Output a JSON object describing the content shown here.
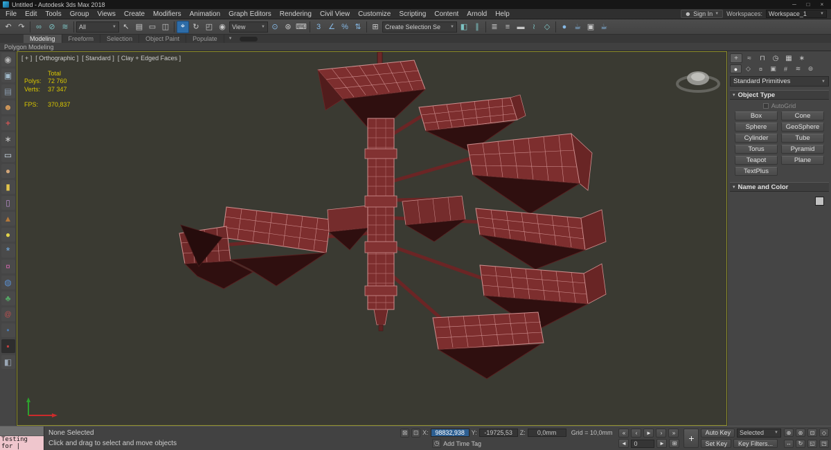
{
  "window": {
    "title": "Untitled - Autodesk 3ds Max 2018"
  },
  "menu": [
    "File",
    "Edit",
    "Tools",
    "Group",
    "Views",
    "Create",
    "Modifiers",
    "Animation",
    "Graph Editors",
    "Rendering",
    "Civil View",
    "Customize",
    "Scripting",
    "Content",
    "Arnold",
    "Help"
  ],
  "account": {
    "sign_in": "Sign In",
    "workspaces_label": "Workspaces:",
    "workspace": "Workspace_1"
  },
  "toolbar": {
    "filter": "All",
    "coord_system": "View",
    "selection_set": "Create Selection Se"
  },
  "ribbon": {
    "tabs": [
      "Modeling",
      "Freeform",
      "Selection",
      "Object Paint",
      "Populate"
    ],
    "panel": "Polygon Modeling"
  },
  "viewport": {
    "label_plus": "[ + ]",
    "label_view": "[ Orthographic ]",
    "label_style": "[ Standard ]",
    "label_shading": "[ Clay + Edged Faces ]",
    "stats": {
      "total": "Total",
      "polys_label": "Polys:",
      "polys": "72 760",
      "verts_label": "Verts:",
      "verts": "37 347",
      "fps_label": "FPS:",
      "fps": "370,837"
    }
  },
  "command_panel": {
    "category": "Standard Primitives",
    "object_type": "Object Type",
    "autogrid": "AutoGrid",
    "buttons": [
      "Box",
      "Cone",
      "Sphere",
      "GeoSphere",
      "Cylinder",
      "Tube",
      "Torus",
      "Pyramid",
      "Teapot",
      "Plane",
      "TextPlus"
    ],
    "name_color": "Name and Color"
  },
  "status": {
    "listener": "Testing for |",
    "prompt": "None Selected",
    "hint": "Click and drag to select and move objects",
    "x_label": "X:",
    "x": "98832,938",
    "y_label": "Y:",
    "y": "-19725,53",
    "z_label": "Z:",
    "z": "0,0mm",
    "grid": "Grid = 10,0mm",
    "add_time_tag": "Add Time Tag",
    "auto_key": "Auto Key",
    "set_key": "Set Key",
    "selected": "Selected",
    "key_filters": "Key Filters...",
    "frame": "0"
  },
  "icons": {
    "minimize": "─",
    "maximize": "□",
    "close": "×",
    "user": "☻",
    "dropdown": "▼",
    "rollout_open": "▾",
    "undo": "↶",
    "redo": "↷",
    "link": "∞",
    "unlink": "⊘",
    "bind": "≋",
    "select": "↖",
    "select_by_name": "▤",
    "region": "▭",
    "crossing": "◫",
    "move": "⌖",
    "rotate": "↻",
    "scale": "◰",
    "place": "◉",
    "pivot": "⊙",
    "manipulate": "⊛",
    "keyboard": "⌨",
    "snap": "3",
    "angle_snap": "∠",
    "percent_snap": "%",
    "spinner_snap": "⇅",
    "named_sets": "⊞",
    "mirror": "◧",
    "align": "∥",
    "scene_explorer": "≣",
    "layer_explorer": "≡",
    "ribbon_toggle": "▬",
    "curve_editor": "≀",
    "schematic": "◇",
    "material": "●",
    "render_setup": "☕",
    "frame_window": "▣",
    "render": "☕",
    "lock": "⊠",
    "abs": "⊡",
    "time_tag": "◷",
    "go_start": "«",
    "prev_frame": "‹",
    "play": "►",
    "next_frame": "›",
    "go_end": "»",
    "spin_left": "◄",
    "spin_right": "►",
    "time_config": "⊞",
    "set_keys": "+",
    "zoom": "⊕",
    "zoom_all": "⊛",
    "zoom_extents": "⊡",
    "fov": "◇",
    "pan": "↔",
    "orbit": "↻",
    "max_toggle": "◱",
    "vp_config": "◳"
  },
  "cp_tabs": [
    "+",
    "≈",
    "⊓",
    "◷",
    "▦",
    "∗"
  ],
  "cp_cats": [
    "●",
    "◇",
    "¤",
    "▣",
    "#",
    "≋",
    "⊚"
  ],
  "left_strip": [
    "◉",
    "▣",
    "▤",
    "☻",
    "+",
    "∗",
    "▭",
    "●",
    "▮",
    "▯",
    "▲",
    "●",
    "*",
    "¤",
    "◍",
    "♣",
    "@",
    "•",
    "▪",
    "◧"
  ]
}
